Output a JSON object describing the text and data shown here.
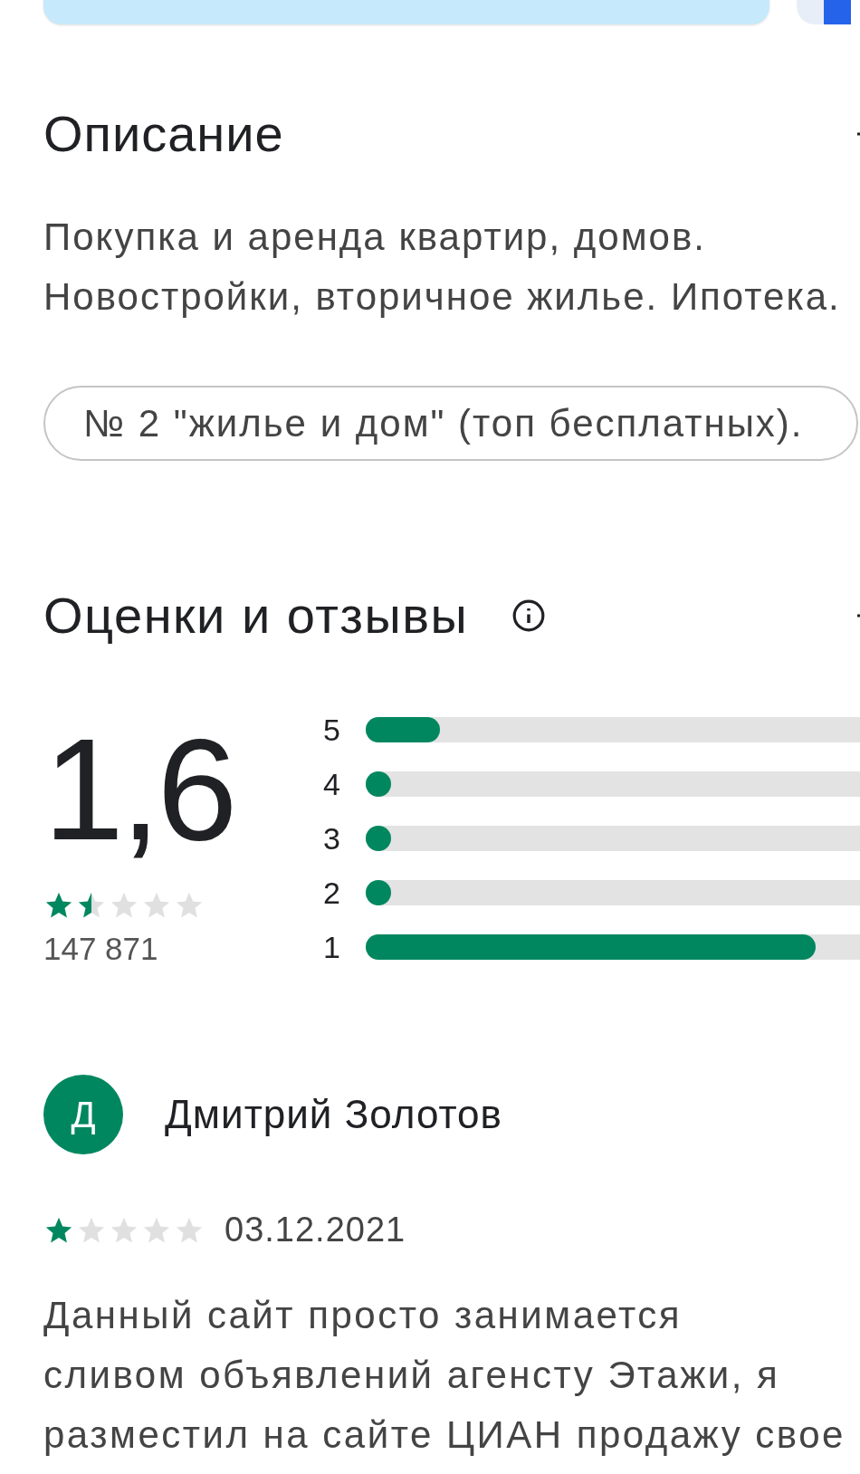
{
  "description": {
    "title": "Описание",
    "lines": [
      "Покупка и аренда квартир, домов.",
      "Новостройки, вторичное жилье. Ипотека."
    ],
    "chip": "№ 2 \"жилье и дом\" (топ бесплатных)."
  },
  "ratings": {
    "title": "Оценки и отзывы",
    "score": "1,6",
    "stars": 1.5,
    "count": "147 871",
    "bars": [
      {
        "label": "5",
        "level": 0.15
      },
      {
        "label": "4",
        "level": 0.01
      },
      {
        "label": "3",
        "level": 0.01
      },
      {
        "label": "2",
        "level": 0.01
      },
      {
        "label": "1",
        "level": 0.91
      }
    ]
  },
  "review": {
    "initial": "Д",
    "author": "Дмитрий Золотов",
    "stars": 1,
    "date": "03.12.2021",
    "lines": [
      "Данный сайт просто занимается",
      "сливом объявлений агенсту Этажи, я",
      "разместил на сайте ЦИАН продажу свое"
    ]
  }
}
